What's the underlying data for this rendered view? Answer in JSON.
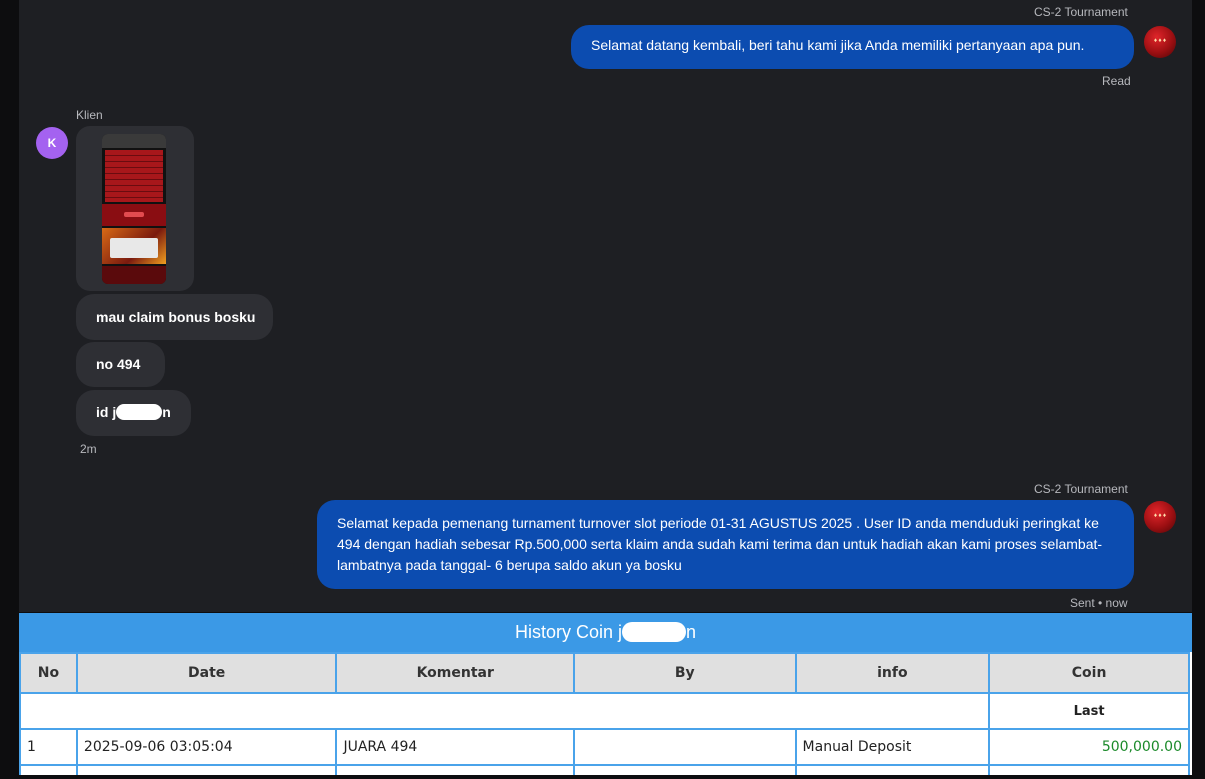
{
  "chat": {
    "messages": [
      {
        "sender": "CS-2 Tournament",
        "text": "Selamat datang kembali, beri tahu kami jika Anda memiliki pertanyaan apa pun.",
        "status": "Read"
      },
      {
        "sender": "Klien",
        "avatar_initial": "K",
        "items": [
          "mau claim bonus bosku",
          "no 494",
          "id j",
          "n"
        ],
        "time": "2m"
      },
      {
        "sender": "CS-2 Tournament",
        "text": "Selamat kepada pemenang turnament turnover slot periode 01-31 AGUSTUS 2025 . User ID anda menduduki peringkat ke 494 dengan hadiah sebesar Rp.500,000 serta klaim anda sudah kami terima dan untuk hadiah akan kami proses selambat-lambatnya pada tanggal- 6 berupa saldo akun ya bosku",
        "status": "Sent • now"
      }
    ]
  },
  "history": {
    "title_prefix": "History Coin j",
    "title_suffix": "n",
    "columns": [
      "No",
      "Date",
      "Komentar",
      "By",
      "info",
      "Coin"
    ],
    "sub_header": "Last",
    "rows": [
      {
        "no": "1",
        "date": "2025-09-06 03:05:04",
        "komentar": "JUARA 494",
        "by": "",
        "info": "Manual Deposit",
        "coin": "500,000.00"
      }
    ]
  },
  "colors": {
    "agent_bubble": "#0c4cb0",
    "client_bubble": "#2e2f34",
    "client_avatar": "#a462f0",
    "table_header": "#3b99e6",
    "coin_positive": "#1b8a2a"
  },
  "icons": {
    "agent_avatar": "brand-logo-avatar",
    "client_avatar": "letter-avatar"
  }
}
